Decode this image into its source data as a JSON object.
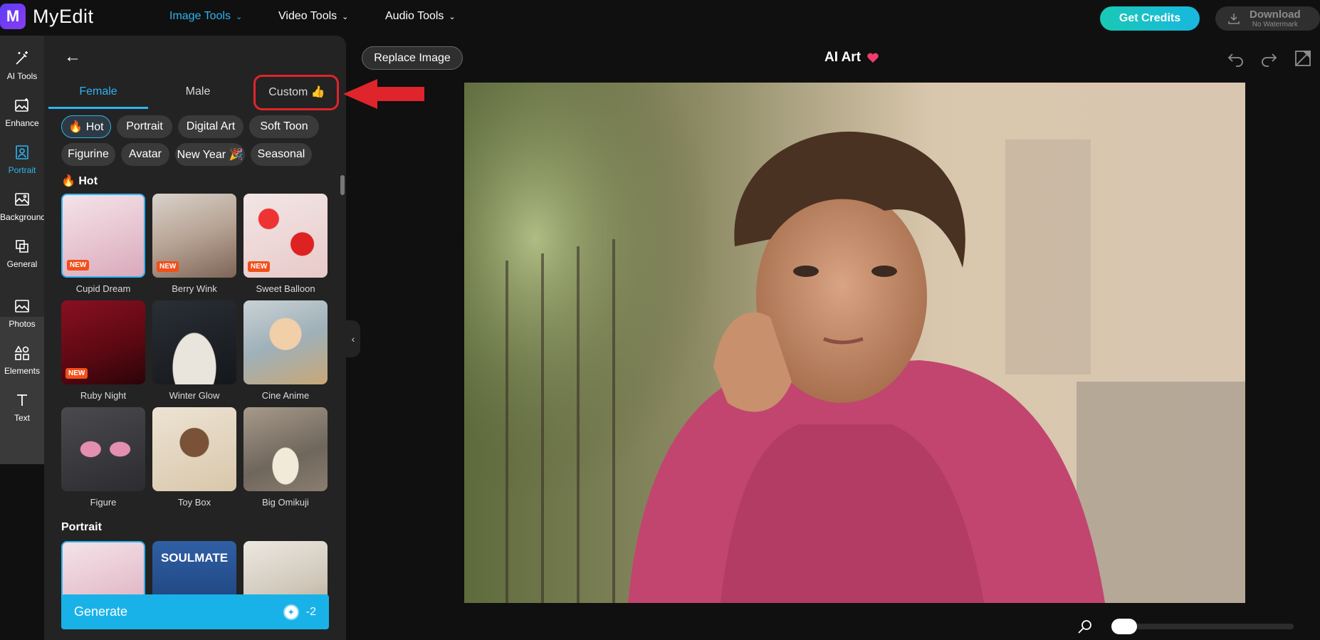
{
  "app": {
    "name": "MyEdit",
    "logo_letter": "M"
  },
  "nav": {
    "items": [
      {
        "label": "Image Tools",
        "active": true
      },
      {
        "label": "Video Tools",
        "active": false
      },
      {
        "label": "Audio Tools",
        "active": false
      }
    ]
  },
  "header": {
    "credits_label": "Get Credits",
    "download_label": "Download",
    "download_sublabel": "No Watermark"
  },
  "toolbar": {
    "items": [
      {
        "label": "AI Tools",
        "icon": "magic-wand-icon"
      },
      {
        "label": "Enhance",
        "icon": "enhance-image-icon"
      },
      {
        "label": "Portrait",
        "icon": "portrait-icon",
        "active": true
      },
      {
        "label": "Background",
        "icon": "background-icon"
      },
      {
        "label": "General",
        "icon": "layers-icon"
      },
      {
        "label": "Photos",
        "icon": "photos-icon"
      },
      {
        "label": "Elements",
        "icon": "shapes-icon"
      },
      {
        "label": "Text",
        "icon": "text-icon"
      }
    ]
  },
  "panel": {
    "tabs": [
      {
        "label": "Female",
        "active": true
      },
      {
        "label": "Male"
      },
      {
        "label": "Custom 👍"
      }
    ],
    "chips": [
      {
        "label": "🔥 Hot",
        "active": true
      },
      {
        "label": "Portrait"
      },
      {
        "label": "Digital Art"
      },
      {
        "label": "Soft Toon"
      },
      {
        "label": "Figurine"
      },
      {
        "label": "Avatar"
      },
      {
        "label": "New Year 🎉"
      },
      {
        "label": "Seasonal"
      }
    ],
    "hot_title": "🔥 Hot",
    "hot_cards": [
      {
        "label": "Cupid Dream",
        "badge": "NEW",
        "selected": true
      },
      {
        "label": "Berry Wink",
        "badge": "NEW"
      },
      {
        "label": "Sweet Balloon",
        "badge": "NEW"
      },
      {
        "label": "Ruby Night",
        "badge": "NEW"
      },
      {
        "label": "Winter Glow"
      },
      {
        "label": "Cine Anime"
      },
      {
        "label": "Figure"
      },
      {
        "label": "Toy Box"
      },
      {
        "label": "Big Omikuji"
      }
    ],
    "portrait_title": "Portrait",
    "portrait_cards": [
      {
        "label": "",
        "selected": true
      },
      {
        "label": "",
        "thumb_text": "SOULMATE"
      },
      {
        "label": ""
      }
    ],
    "generate_label": "Generate",
    "generate_cost": "-2"
  },
  "canvas": {
    "replace_label": "Replace Image",
    "title": "AI Art"
  }
}
